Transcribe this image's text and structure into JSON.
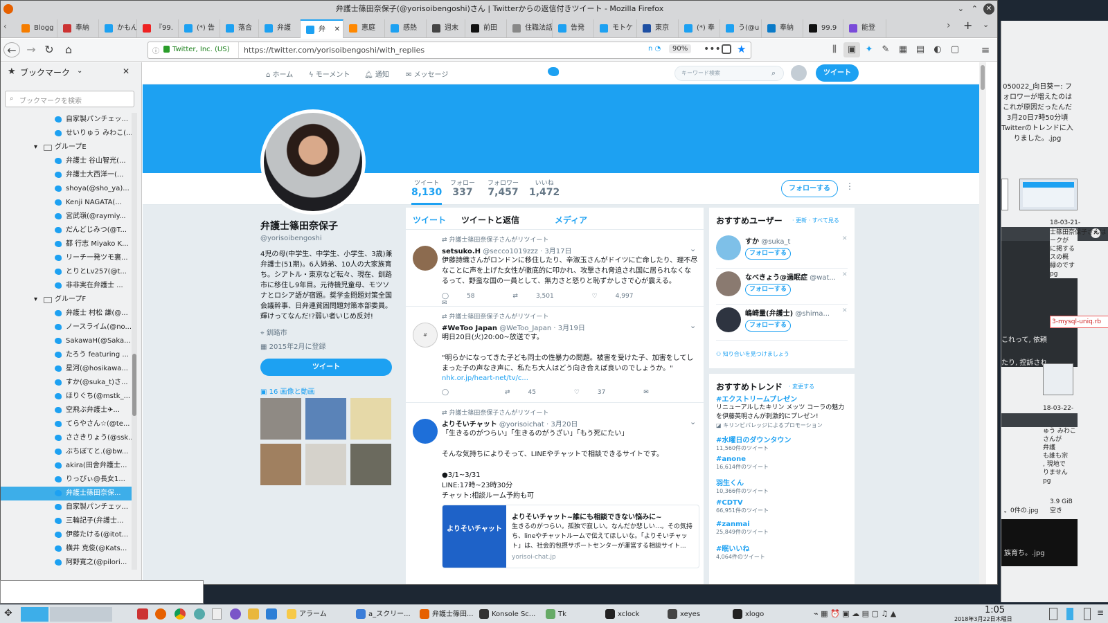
{
  "window": {
    "title": "弁護士篠田奈保子(@yorisoibengoshi)さん | Twitterからの返信付きツイート - Mozilla Firefox"
  },
  "tabs": [
    {
      "label": "Blogg",
      "color": "#f57d00"
    },
    {
      "label": "奉納",
      "color": "#c33"
    },
    {
      "label": "かもん",
      "color": "#1da1f2"
    },
    {
      "label": "『99.",
      "color": "#e22"
    },
    {
      "label": "(*) 告",
      "color": "#1da1f2"
    },
    {
      "label": "落合",
      "color": "#1da1f2"
    },
    {
      "label": "弁護",
      "color": "#1da1f2"
    },
    {
      "label": "弁",
      "color": "#1da1f2"
    },
    {
      "label": "恵庭",
      "color": "#f80"
    },
    {
      "label": "感熱",
      "color": "#1da1f2"
    },
    {
      "label": "週末",
      "color": "#444"
    },
    {
      "label": "前田",
      "color": "#111"
    },
    {
      "label": "住職法話",
      "color": "#888"
    },
    {
      "label": "告発",
      "color": "#1da1f2"
    },
    {
      "label": "モトケ",
      "color": "#1da1f2"
    },
    {
      "label": "東京",
      "color": "#1e4fa3"
    },
    {
      "label": "(*) 奉",
      "color": "#1da1f2"
    },
    {
      "label": "う(@u",
      "color": "#1da1f2"
    },
    {
      "label": "奉納",
      "color": "#0a7ac8"
    },
    {
      "label": "99.9",
      "color": "#111"
    },
    {
      "label": "能登",
      "color": "#7a4bd9"
    }
  ],
  "nav": {
    "site_identity": "Twitter, Inc. (US)",
    "url": "https://twitter.com/yorisoibengoshi/with_replies",
    "zoom": "90%"
  },
  "sidebar": {
    "title": "ブックマーク",
    "search_placeholder": "ブックマークを検索",
    "items": [
      {
        "label": "自家製パンチェッ...",
        "type": "bm"
      },
      {
        "label": "せいりゅう みわこ(...",
        "type": "bm"
      },
      {
        "label": "グループE",
        "type": "folder"
      },
      {
        "label": "弁護士 谷山智光(...",
        "type": "bm"
      },
      {
        "label": "弁護士大西洋一(...",
        "type": "bm"
      },
      {
        "label": "shoya(@sho_ya)...",
        "type": "bm"
      },
      {
        "label": "Kenji NAGATA(...",
        "type": "bm"
      },
      {
        "label": "宮武嶺(@raymiy...",
        "type": "bm"
      },
      {
        "label": "だんどじみつ(@T...",
        "type": "bm"
      },
      {
        "label": "都 行志 Miyako K...",
        "type": "bm"
      },
      {
        "label": "リーチ一発ツモ裏...",
        "type": "bm"
      },
      {
        "label": "とりとLv257(@t...",
        "type": "bm"
      },
      {
        "label": "非非実在弁護士 ...",
        "type": "bm"
      },
      {
        "label": "グループF",
        "type": "folder"
      },
      {
        "label": "弁護士 村松 謙(@...",
        "type": "bm"
      },
      {
        "label": "ノースライム(@no...",
        "type": "bm"
      },
      {
        "label": "SakawaH(@Saka...",
        "type": "bm"
      },
      {
        "label": "たろう featuring ...",
        "type": "bm"
      },
      {
        "label": "星河(@hosikawa...",
        "type": "bm"
      },
      {
        "label": "すか(@suka_t)さ...",
        "type": "bm"
      },
      {
        "label": "ほりぐち(@mstk_...",
        "type": "bm"
      },
      {
        "label": "空飛ぶ弁護士✈...",
        "type": "bm"
      },
      {
        "label": "てらやさん☆(@te...",
        "type": "bm"
      },
      {
        "label": "ささきりょう(@ssk...",
        "type": "bm"
      },
      {
        "label": "ぶちぼてと.(@bw...",
        "type": "bm"
      },
      {
        "label": "akira(田舎弁護士...",
        "type": "bm"
      },
      {
        "label": "りっぴぃ@長女1...",
        "type": "bm"
      },
      {
        "label": "弁護士篠田奈保...",
        "type": "bm",
        "selected": true
      },
      {
        "label": "自家製パンチェッ...",
        "type": "bm"
      },
      {
        "label": "三輪記子(弁護士...",
        "type": "bm"
      },
      {
        "label": "伊藤たける(@itot...",
        "type": "bm"
      },
      {
        "label": "横井 克俊(@Kats...",
        "type": "bm"
      },
      {
        "label": "阿野寛之(@pilori...",
        "type": "bm"
      }
    ]
  },
  "twitter_nav": {
    "home": "ホーム",
    "moments": "モーメント",
    "notifications": "通知",
    "messages": "メッセージ",
    "search_placeholder": "キーワード検索",
    "tweet_button": "ツイート"
  },
  "profile": {
    "name": "弁護士篠田奈保子",
    "handle": "@yorisoibengoshi",
    "bio": "4児の母(中学生、中学生、小学生、3歳)兼弁護士(51期)。6人姉弟、10人の大家族育ち。シアトル・東京など転々、現在、釧路市に移住し9年目。元待機児童母、モツソナとロシア語が宿題。奨学金問題対策全国会議幹事、日弁連貧困問題対策本部委員。輝けってなんだ!?弱い者いじめ反対!",
    "location": "釧路市",
    "joined": "2015年2月に登録",
    "tweet_button": "ツイート",
    "media_link": "16 画像と動画",
    "follow_button": "フォローする"
  },
  "stats": [
    {
      "label": "ツイート",
      "value": "8,130"
    },
    {
      "label": "フォロー",
      "value": "337"
    },
    {
      "label": "フォロワー",
      "value": "7,457"
    },
    {
      "label": "いいね",
      "value": "1,472"
    }
  ],
  "timeline_tabs": [
    "ツイート",
    "ツイートと返信",
    "メディア"
  ],
  "tweets": [
    {
      "retweet_by": "弁護士篠田奈保子さんがリツイート",
      "name": "setsuko.H",
      "meta": "@secco1019zzz · 3月17日",
      "text": "伊藤詩織さんがロンドンに移住したり、辛淑玉さんがドイツに亡命したり、理不尽なことに声を上げた女性が徹底的に叩かれ、攻撃され脅迫され国に居られなくなるって、野蛮な国の一員として、無力さと怒りと恥ずかしさで心が震える。",
      "replies": "58",
      "retweets": "3,501",
      "likes": "4,997"
    },
    {
      "retweet_by": "弁護士篠田奈保子さんがリツイート",
      "name": "#WeToo Japan",
      "meta": "@WeToo_Japan · 3月19日",
      "text": "明日20日(火)20:00~放送です。\n\n\"明らかになってきた子ども同士の性暴力の問題。被害を受けた子、加害をしてしまった子の声なき声に、私たち大人はどう向き合えば良いのでしょうか。\"",
      "link": "nhk.or.jp/heart-net/tv/c...",
      "replies": "",
      "retweets": "45",
      "likes": "37"
    },
    {
      "retweet_by": "弁護士篠田奈保子さんがリツイート",
      "name": "よりそいチャット",
      "meta": "@yorisoichat · 3月20日",
      "text": "「生きるのがつらい」「生きるのがうざい」「もう死にたい」\n\nそんな気持ちによりそって、LINEやチャットで相談できるサイトです。\n\n●3/1~3/31\nLINE:17時~23時30分\nチャット:相談ルーム予約も可",
      "card_title": "よりそいチャット~誰にも相談できない悩みに~",
      "card_desc": "生きるのがつらい。孤独で寂しい。なんだか悲しい…。その気持ち、lineやチャットルームで伝えてほしいな。「よりそいチャット」は、社会的包摂サポートセンターが運営する相談サイト...",
      "card_domain": "yorisoi-chat.jp",
      "card_image_text": "よりそいチャット"
    }
  ],
  "suggestions": {
    "title": "おすすめユーザー",
    "refresh": "更新",
    "view_all": "すべて見る",
    "users": [
      {
        "name": "すか",
        "handle": "@suka_t"
      },
      {
        "name": "なべきょう@過眠症",
        "handle": "@wat..."
      },
      {
        "name": "嶋崎量(弁護士)",
        "handle": "@shima..."
      }
    ],
    "follow_label": "フォローする",
    "find_friends": "知り合いを見つけましょう"
  },
  "trends": {
    "title": "おすすめトレンド",
    "change": "変更する",
    "items": [
      {
        "tag": "#エクストリームプレゼン",
        "desc": "リニューアルしたキリン メッツ コーラの魅力を伊藤英明さんが刺激的にプレゼン!",
        "count": "キリンビバレッジによるプロモーション"
      },
      {
        "tag": "#水曜日のダウンタウン",
        "count": "11,560件のツイート"
      },
      {
        "tag": "#anone",
        "count": "16,614件のツイート"
      },
      {
        "tag": "羽生くん",
        "count": "10,366件のツイート"
      },
      {
        "tag": "#CDTV",
        "count": "66,951件のツイート"
      },
      {
        "tag": "#zanmai",
        "count": "25,849件のツイート"
      },
      {
        "tag": "#眠いいね",
        "count": "4,064件のツイート"
      }
    ]
  },
  "right_window": {
    "lines": [
      "050022_向日葵ー: フォロワーが増えたのはこれが原因だったんだ3月20日7時50分頃Twitterのトレンドに入りました。.jpg"
    ],
    "file1": "18-03-21-",
    "file1b": "士篠田奈保子さんは\nークが\nに掲する\nスの概\n緑のです\npg",
    "mysql": "3-mysql-uniq.rb",
    "term1": "これって, 依頼",
    "term2": "たり, 控訴され",
    "file2": "18-03-22-",
    "file2b": "ゅう みわこ\nさんが\n弁護\nも誰も宗\n, 現地で\nりません\npg",
    "size": "3.9 GiB 空き",
    "zero": "。0件の.jpg",
    "sodachi": "族育ち。.jpg"
  },
  "taskbar": {
    "items": [
      "アラーム",
      "a_スクリー...",
      "弁護士篠田...",
      "Konsole Sc...",
      "Tk",
      "xclock",
      "xeyes",
      "xlogo"
    ],
    "clock_time": "1:05",
    "clock_date": "2018年3月22日木曜日"
  }
}
